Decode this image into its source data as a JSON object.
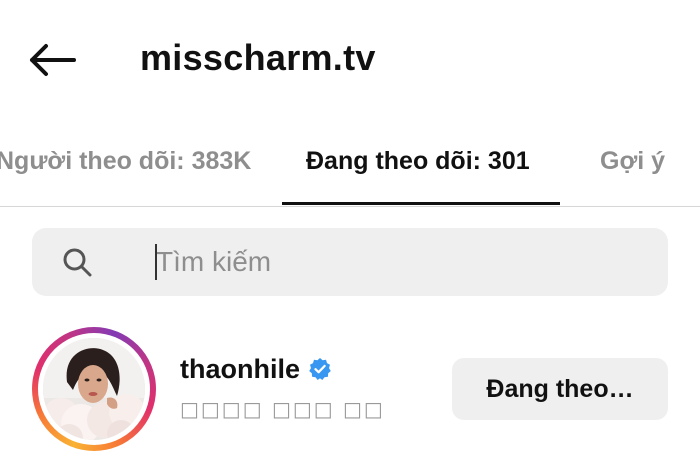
{
  "header": {
    "back_icon": "arrow-left-icon",
    "title": "misscharm.tv"
  },
  "tabs": [
    {
      "label": "Người theo dõi: 383K",
      "active": false
    },
    {
      "label": "Đang theo dõi: 301",
      "active": true
    },
    {
      "label": "Gợi ý",
      "active": false
    }
  ],
  "search": {
    "icon": "search-icon",
    "placeholder": "Tìm kiếm",
    "value": ""
  },
  "following_list": [
    {
      "username": "thaonhile",
      "verified": true,
      "verified_icon": "verified-badge-icon",
      "full_name": "□□□□ □□□ □□",
      "button_label": "Đang theo…",
      "story_ring": true
    }
  ],
  "colors": {
    "accent_blue": "#3897f0",
    "muted_text": "#8e8e8e",
    "button_bg": "#efefef",
    "active_tab_underline": "#111111"
  }
}
